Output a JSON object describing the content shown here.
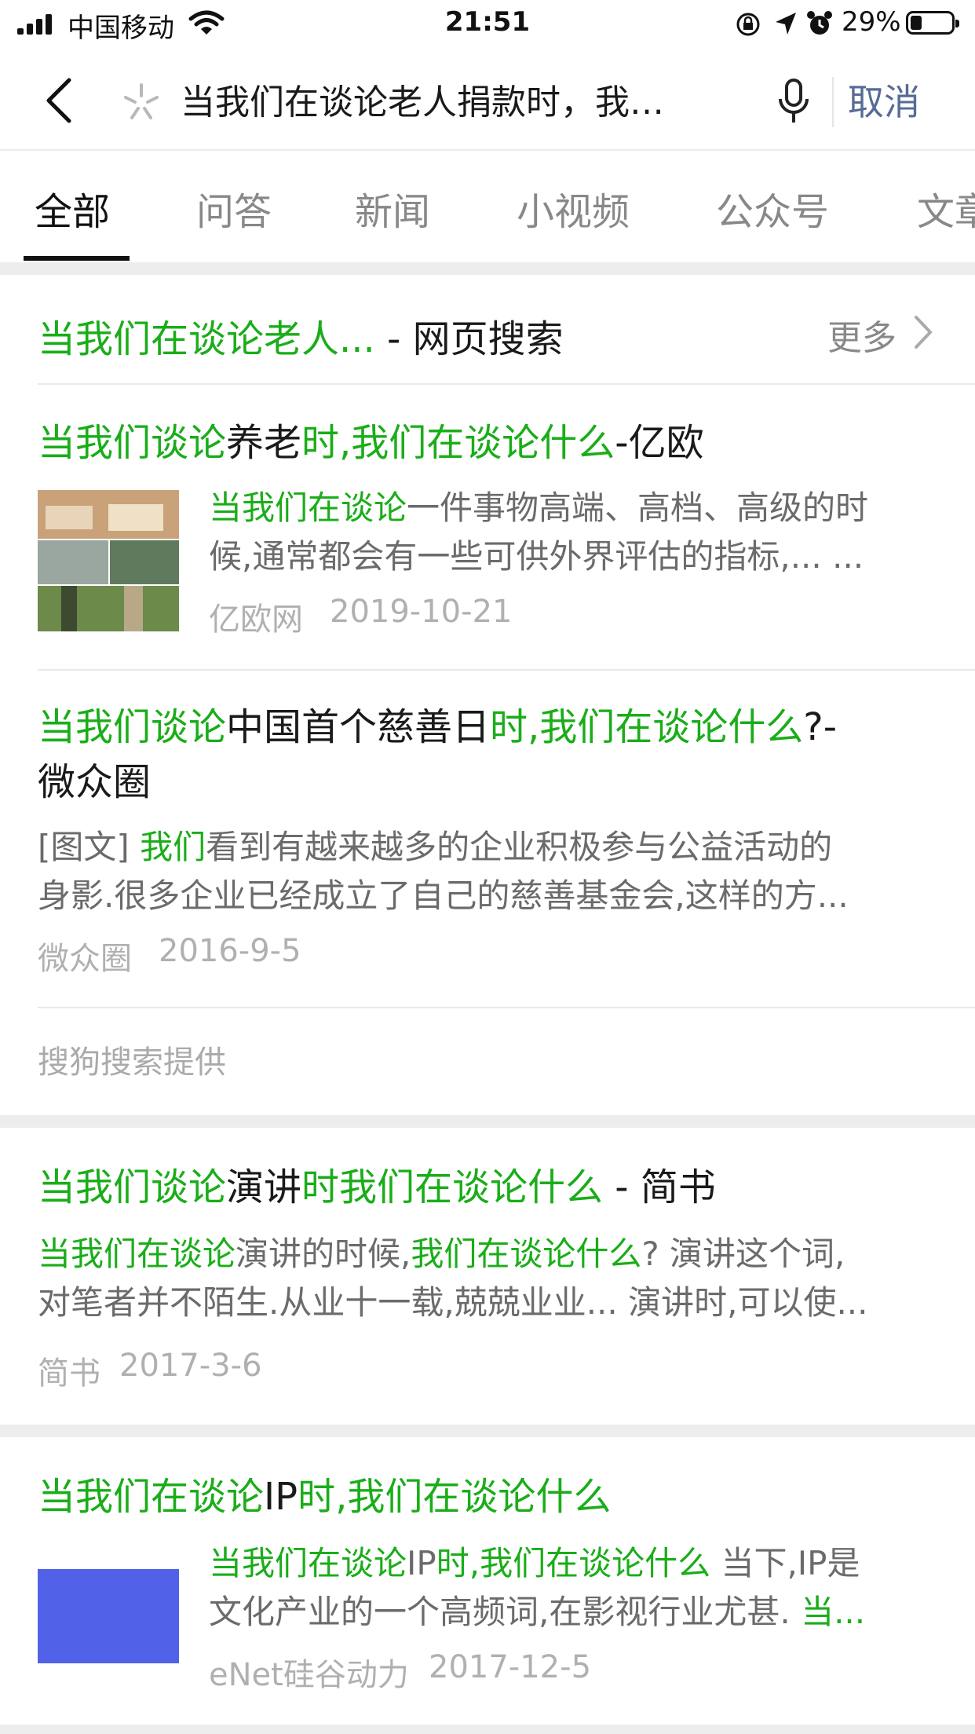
{
  "status_bar": {
    "carrier": "中国移动",
    "time": "21:51",
    "battery_percent": "29%",
    "battery_level": 0.29
  },
  "search": {
    "back_icon": "chevron-left-icon",
    "brand_icon": "sparkle-icon",
    "query": "当我们在谈论老人捐款时，我…",
    "mic_icon": "microphone-icon",
    "cancel_label": "取消"
  },
  "tabs": [
    {
      "label": "全部",
      "active": true
    },
    {
      "label": "问答",
      "active": false
    },
    {
      "label": "新闻",
      "active": false
    },
    {
      "label": "小视频",
      "active": false
    },
    {
      "label": "公众号",
      "active": false
    },
    {
      "label": "文章",
      "active": false
    }
  ],
  "web_section": {
    "title_highlight": "当我们在谈论老人...",
    "title_suffix": " - 网页搜索",
    "more_label": "更多",
    "provider": "搜狗搜索提供",
    "results": [
      {
        "title_parts": [
          {
            "text": "当我们谈论",
            "hl": true
          },
          {
            "text": "养老",
            "hl": false
          },
          {
            "text": "时,我们在谈论什么",
            "hl": true
          },
          {
            "text": "-亿欧",
            "hl": false
          }
        ],
        "snippet_line1_hl": "当我们在谈论",
        "snippet_line1_rest": "一件事物高端、高档、高级的时",
        "snippet_line2": "候,通常都会有一些可供外界评估的指标,... ...",
        "source": "亿欧网",
        "date": "2019-10-21"
      },
      {
        "title_line1_parts": [
          {
            "text": "当我们谈论",
            "hl": true
          },
          {
            "text": "中国首个慈善日",
            "hl": false
          },
          {
            "text": "时,我们在谈论什么",
            "hl": true
          },
          {
            "text": "?-",
            "hl": false
          }
        ],
        "title_line2": "微众圈",
        "snippet_prefix": "[图文] ",
        "snippet_hl": "我们",
        "snippet_line1_rest": "看到有越来越多的企业积极参与公益活动的",
        "snippet_line2": "身影.很多企业已经成立了自己的慈善基金会,这样的方...",
        "source": "微众圈",
        "date": "2016-9-5"
      }
    ]
  },
  "results": [
    {
      "title_parts": [
        {
          "text": "当我们谈论",
          "hl": true
        },
        {
          "text": "演讲",
          "hl": false
        },
        {
          "text": "时我们在谈论什么",
          "hl": true
        },
        {
          "text": " - 简书",
          "hl": false
        }
      ],
      "snippet_line1_parts": [
        {
          "text": "当我们在谈论",
          "hl": true
        },
        {
          "text": "演讲的时候,",
          "hl": false
        },
        {
          "text": "我们在谈论什么",
          "hl": true
        },
        {
          "text": "? 演讲这个词,",
          "hl": false
        }
      ],
      "snippet_line2": "对笔者并不陌生.从业十一载,兢兢业业... 演讲时,可以使...",
      "source": "简书",
      "date": "2017-3-6"
    },
    {
      "title_parts": [
        {
          "text": "当我们在谈论",
          "hl": true
        },
        {
          "text": "IP",
          "hl": false
        },
        {
          "text": "时,我们在谈论什么",
          "hl": true
        }
      ],
      "snippet_line1_parts": [
        {
          "text": "当我们在谈论",
          "hl": true
        },
        {
          "text": "IP",
          "hl": false
        },
        {
          "text": "时,我们在谈论什么",
          "hl": true
        },
        {
          "text": " 当下,IP是",
          "hl": false
        }
      ],
      "snippet_line2_rest": "文化产业的一个高频词,在影视行业尤甚. ",
      "snippet_line2_hl": "当...",
      "source": "eNet硅谷动力",
      "date": "2017-12-5",
      "thumb_color": "#5161e8"
    }
  ],
  "colors": {
    "highlight": "#1aad19",
    "cancel": "#576b95",
    "gray_text": "#9a9a9a"
  }
}
